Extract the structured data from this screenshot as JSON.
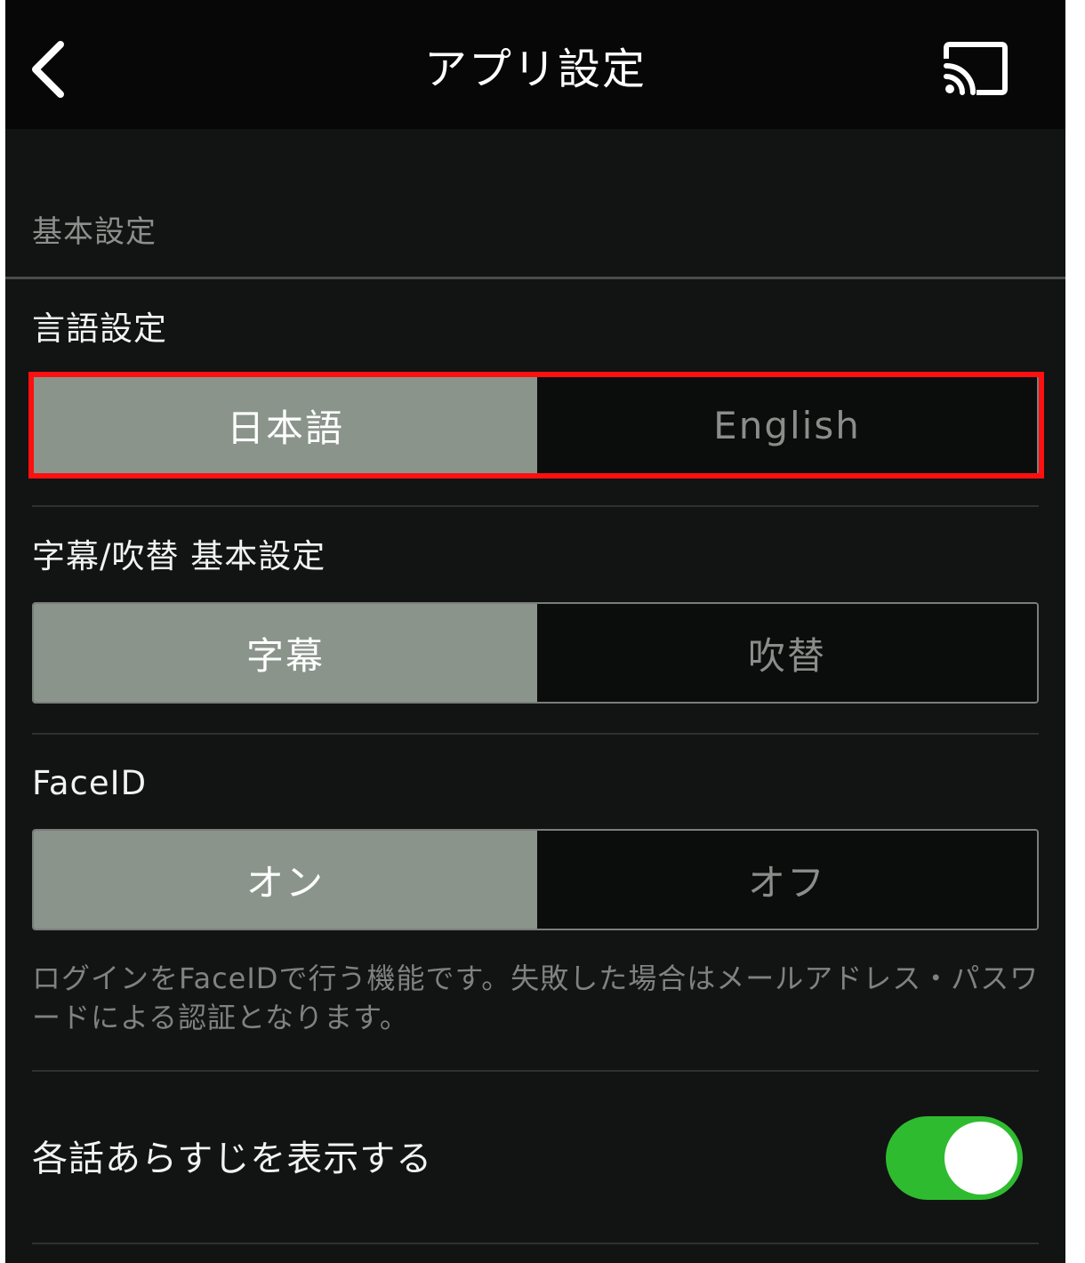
{
  "header": {
    "title": "アプリ設定",
    "back_icon": "chevron-left-icon",
    "cast_icon": "cast-icon"
  },
  "section": {
    "label": "基本設定"
  },
  "language": {
    "label": "言語設定",
    "options": [
      "日本語",
      "English"
    ],
    "selected": "日本語"
  },
  "audio": {
    "label": "字幕/吹替 基本設定",
    "options": [
      "字幕",
      "吹替"
    ],
    "selected": "字幕"
  },
  "faceid": {
    "label": "FaceID",
    "options": [
      "オン",
      "オフ"
    ],
    "selected": "オン",
    "note": "ログインをFaceIDで行う機能です。失敗した場合はメールアドレス・パスワードによる認証となります。"
  },
  "synopsis": {
    "label": "各話あらすじを表示する",
    "enabled": true
  },
  "colors": {
    "background": "#121313",
    "header": "#070707",
    "selected_segment": "#8a948b",
    "toggle_on": "#2fbb2f",
    "highlight": "#ff1010"
  }
}
